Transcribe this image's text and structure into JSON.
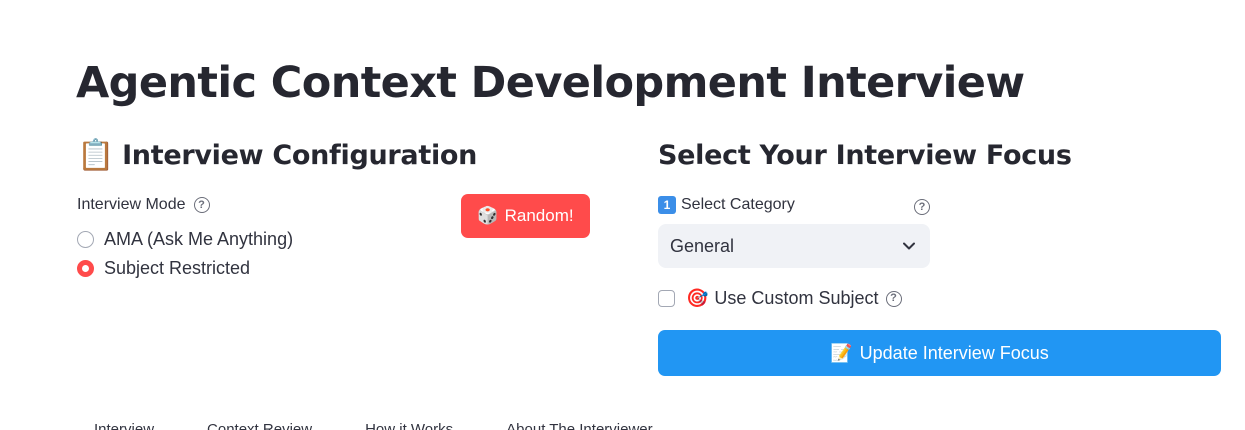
{
  "page": {
    "title": "Agentic Context Development Interview"
  },
  "config": {
    "title_emoji": "📋",
    "title": "Interview Configuration",
    "mode_label": "Interview Mode",
    "help_glyph": "?",
    "mode_options": [
      {
        "label": "AMA (Ask Me Anything)",
        "checked": false
      },
      {
        "label": "Subject Restricted",
        "checked": true
      }
    ],
    "random_button": {
      "emoji": "🎲",
      "label": "Random!"
    }
  },
  "focus": {
    "title": "Select Your Interview Focus",
    "category_badge": "1",
    "category_label": "Select Category",
    "selected_category": "General",
    "custom_subject_emoji": "🎯",
    "custom_subject_label": "Use Custom Subject",
    "custom_subject_checked": false,
    "update_button": {
      "emoji": "📝",
      "label": "Update Interview Focus"
    }
  },
  "tabs": [
    {
      "label": "Interview"
    },
    {
      "label": "Context Review"
    },
    {
      "label": "How it Works"
    },
    {
      "label": "About The Interviewer"
    }
  ],
  "colors": {
    "primary": "#ff4b4b",
    "accent_blue": "#2196f3",
    "text": "#262730",
    "select_bg": "#f0f2f6"
  }
}
